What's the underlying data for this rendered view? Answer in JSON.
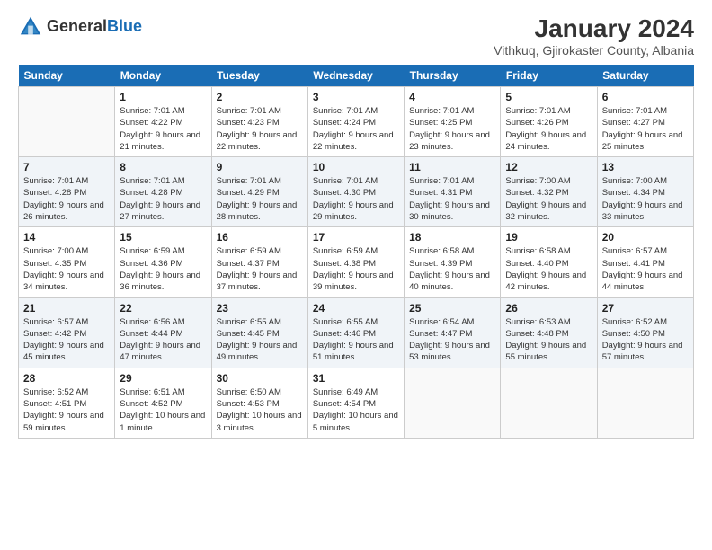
{
  "header": {
    "logo_general": "General",
    "logo_blue": "Blue",
    "month_title": "January 2024",
    "location": "Vithkuq, Gjirokaster County, Albania"
  },
  "days_of_week": [
    "Sunday",
    "Monday",
    "Tuesday",
    "Wednesday",
    "Thursday",
    "Friday",
    "Saturday"
  ],
  "weeks": [
    [
      {
        "day": "",
        "sunrise": "",
        "sunset": "",
        "daylight": ""
      },
      {
        "day": "1",
        "sunrise": "Sunrise: 7:01 AM",
        "sunset": "Sunset: 4:22 PM",
        "daylight": "Daylight: 9 hours and 21 minutes."
      },
      {
        "day": "2",
        "sunrise": "Sunrise: 7:01 AM",
        "sunset": "Sunset: 4:23 PM",
        "daylight": "Daylight: 9 hours and 22 minutes."
      },
      {
        "day": "3",
        "sunrise": "Sunrise: 7:01 AM",
        "sunset": "Sunset: 4:24 PM",
        "daylight": "Daylight: 9 hours and 22 minutes."
      },
      {
        "day": "4",
        "sunrise": "Sunrise: 7:01 AM",
        "sunset": "Sunset: 4:25 PM",
        "daylight": "Daylight: 9 hours and 23 minutes."
      },
      {
        "day": "5",
        "sunrise": "Sunrise: 7:01 AM",
        "sunset": "Sunset: 4:26 PM",
        "daylight": "Daylight: 9 hours and 24 minutes."
      },
      {
        "day": "6",
        "sunrise": "Sunrise: 7:01 AM",
        "sunset": "Sunset: 4:27 PM",
        "daylight": "Daylight: 9 hours and 25 minutes."
      }
    ],
    [
      {
        "day": "7",
        "sunrise": "Sunrise: 7:01 AM",
        "sunset": "Sunset: 4:28 PM",
        "daylight": "Daylight: 9 hours and 26 minutes."
      },
      {
        "day": "8",
        "sunrise": "Sunrise: 7:01 AM",
        "sunset": "Sunset: 4:28 PM",
        "daylight": "Daylight: 9 hours and 27 minutes."
      },
      {
        "day": "9",
        "sunrise": "Sunrise: 7:01 AM",
        "sunset": "Sunset: 4:29 PM",
        "daylight": "Daylight: 9 hours and 28 minutes."
      },
      {
        "day": "10",
        "sunrise": "Sunrise: 7:01 AM",
        "sunset": "Sunset: 4:30 PM",
        "daylight": "Daylight: 9 hours and 29 minutes."
      },
      {
        "day": "11",
        "sunrise": "Sunrise: 7:01 AM",
        "sunset": "Sunset: 4:31 PM",
        "daylight": "Daylight: 9 hours and 30 minutes."
      },
      {
        "day": "12",
        "sunrise": "Sunrise: 7:00 AM",
        "sunset": "Sunset: 4:32 PM",
        "daylight": "Daylight: 9 hours and 32 minutes."
      },
      {
        "day": "13",
        "sunrise": "Sunrise: 7:00 AM",
        "sunset": "Sunset: 4:34 PM",
        "daylight": "Daylight: 9 hours and 33 minutes."
      }
    ],
    [
      {
        "day": "14",
        "sunrise": "Sunrise: 7:00 AM",
        "sunset": "Sunset: 4:35 PM",
        "daylight": "Daylight: 9 hours and 34 minutes."
      },
      {
        "day": "15",
        "sunrise": "Sunrise: 6:59 AM",
        "sunset": "Sunset: 4:36 PM",
        "daylight": "Daylight: 9 hours and 36 minutes."
      },
      {
        "day": "16",
        "sunrise": "Sunrise: 6:59 AM",
        "sunset": "Sunset: 4:37 PM",
        "daylight": "Daylight: 9 hours and 37 minutes."
      },
      {
        "day": "17",
        "sunrise": "Sunrise: 6:59 AM",
        "sunset": "Sunset: 4:38 PM",
        "daylight": "Daylight: 9 hours and 39 minutes."
      },
      {
        "day": "18",
        "sunrise": "Sunrise: 6:58 AM",
        "sunset": "Sunset: 4:39 PM",
        "daylight": "Daylight: 9 hours and 40 minutes."
      },
      {
        "day": "19",
        "sunrise": "Sunrise: 6:58 AM",
        "sunset": "Sunset: 4:40 PM",
        "daylight": "Daylight: 9 hours and 42 minutes."
      },
      {
        "day": "20",
        "sunrise": "Sunrise: 6:57 AM",
        "sunset": "Sunset: 4:41 PM",
        "daylight": "Daylight: 9 hours and 44 minutes."
      }
    ],
    [
      {
        "day": "21",
        "sunrise": "Sunrise: 6:57 AM",
        "sunset": "Sunset: 4:42 PM",
        "daylight": "Daylight: 9 hours and 45 minutes."
      },
      {
        "day": "22",
        "sunrise": "Sunrise: 6:56 AM",
        "sunset": "Sunset: 4:44 PM",
        "daylight": "Daylight: 9 hours and 47 minutes."
      },
      {
        "day": "23",
        "sunrise": "Sunrise: 6:55 AM",
        "sunset": "Sunset: 4:45 PM",
        "daylight": "Daylight: 9 hours and 49 minutes."
      },
      {
        "day": "24",
        "sunrise": "Sunrise: 6:55 AM",
        "sunset": "Sunset: 4:46 PM",
        "daylight": "Daylight: 9 hours and 51 minutes."
      },
      {
        "day": "25",
        "sunrise": "Sunrise: 6:54 AM",
        "sunset": "Sunset: 4:47 PM",
        "daylight": "Daylight: 9 hours and 53 minutes."
      },
      {
        "day": "26",
        "sunrise": "Sunrise: 6:53 AM",
        "sunset": "Sunset: 4:48 PM",
        "daylight": "Daylight: 9 hours and 55 minutes."
      },
      {
        "day": "27",
        "sunrise": "Sunrise: 6:52 AM",
        "sunset": "Sunset: 4:50 PM",
        "daylight": "Daylight: 9 hours and 57 minutes."
      }
    ],
    [
      {
        "day": "28",
        "sunrise": "Sunrise: 6:52 AM",
        "sunset": "Sunset: 4:51 PM",
        "daylight": "Daylight: 9 hours and 59 minutes."
      },
      {
        "day": "29",
        "sunrise": "Sunrise: 6:51 AM",
        "sunset": "Sunset: 4:52 PM",
        "daylight": "Daylight: 10 hours and 1 minute."
      },
      {
        "day": "30",
        "sunrise": "Sunrise: 6:50 AM",
        "sunset": "Sunset: 4:53 PM",
        "daylight": "Daylight: 10 hours and 3 minutes."
      },
      {
        "day": "31",
        "sunrise": "Sunrise: 6:49 AM",
        "sunset": "Sunset: 4:54 PM",
        "daylight": "Daylight: 10 hours and 5 minutes."
      },
      {
        "day": "",
        "sunrise": "",
        "sunset": "",
        "daylight": ""
      },
      {
        "day": "",
        "sunrise": "",
        "sunset": "",
        "daylight": ""
      },
      {
        "day": "",
        "sunrise": "",
        "sunset": "",
        "daylight": ""
      }
    ]
  ]
}
